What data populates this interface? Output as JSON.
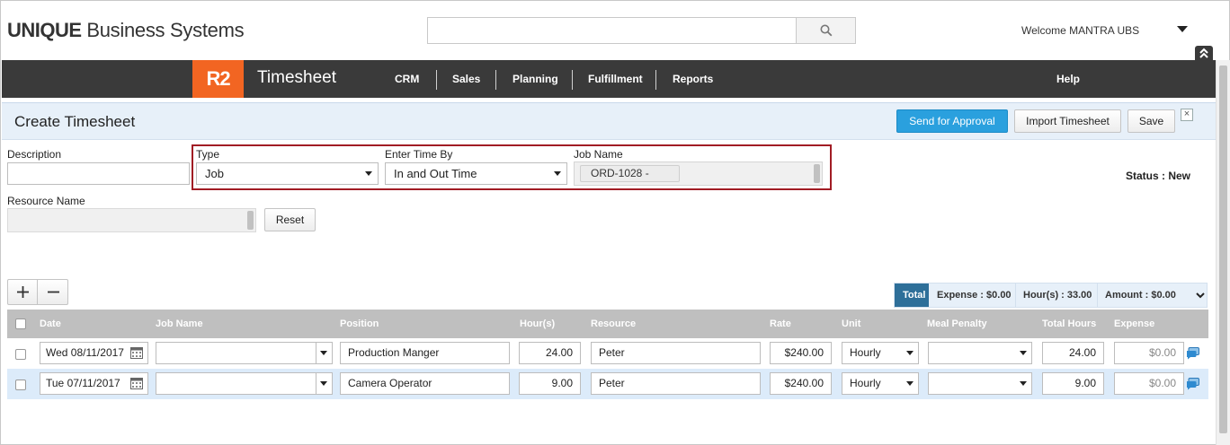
{
  "brand": {
    "logo_bold": "UNIQUE",
    "logo_rest": " Business Systems",
    "badge": "R2",
    "app_title": "Timesheet"
  },
  "search": {
    "value": "",
    "placeholder": ""
  },
  "user": {
    "welcome": "Welcome MANTRA UBS"
  },
  "nav": {
    "items": [
      {
        "label": "CRM"
      },
      {
        "label": "Sales"
      },
      {
        "label": "Planning"
      },
      {
        "label": "Fulfillment"
      },
      {
        "label": "Reports"
      }
    ],
    "help": "Help"
  },
  "page": {
    "title": "Create Timesheet",
    "buttons": {
      "send": "Send for Approval",
      "import": "Import Timesheet",
      "save": "Save"
    }
  },
  "form": {
    "description_label": "Description",
    "description_value": "",
    "type_label": "Type",
    "type_value": "Job",
    "enter_time_label": "Enter Time By",
    "enter_time_value": "In and Out Time",
    "job_name_label": "Job Name",
    "job_name_chip": "ORD-1028 -",
    "resource_label": "Resource Name",
    "reset": "Reset",
    "status": "Status : New"
  },
  "totals": {
    "total": "Total",
    "expense": "Expense : $0.00",
    "hours": "Hour(s) : 33.00",
    "amount": "Amount : $0.00"
  },
  "grid": {
    "headers": {
      "date": "Date",
      "job_name": "Job Name",
      "position": "Position",
      "hours": "Hour(s)",
      "resource": "Resource",
      "rate": "Rate",
      "unit": "Unit",
      "meal_penalty": "Meal Penalty",
      "total_hours": "Total Hours",
      "expense": "Expense"
    },
    "rows": [
      {
        "date": "Wed 08/11/2017",
        "job_name": "",
        "position": "Production Manger",
        "hours": "24.00",
        "resource": "Peter",
        "rate": "$240.00",
        "unit": "Hourly",
        "meal_penalty": "",
        "total_hours": "24.00",
        "expense": "$0.00"
      },
      {
        "date": "Tue 07/11/2017",
        "job_name": "",
        "position": "Camera Operator",
        "hours": "9.00",
        "resource": "Peter",
        "rate": "$240.00",
        "unit": "Hourly",
        "meal_penalty": "",
        "total_hours": "9.00",
        "expense": "$0.00"
      }
    ]
  },
  "colors": {
    "nav_bg": "#3a3a3a",
    "badge": "#f26522",
    "primary_button": "#2aa0de",
    "highlight_border": "#a11c24",
    "selected_row": "#dcebfa",
    "total_tab": "#2e6f99"
  },
  "icons": {
    "search": "search-icon",
    "caret": "caret-down-icon",
    "collapse": "double-chevron-up-icon",
    "calendar": "calendar-icon",
    "comment": "comment-icon",
    "close": "close-icon"
  }
}
